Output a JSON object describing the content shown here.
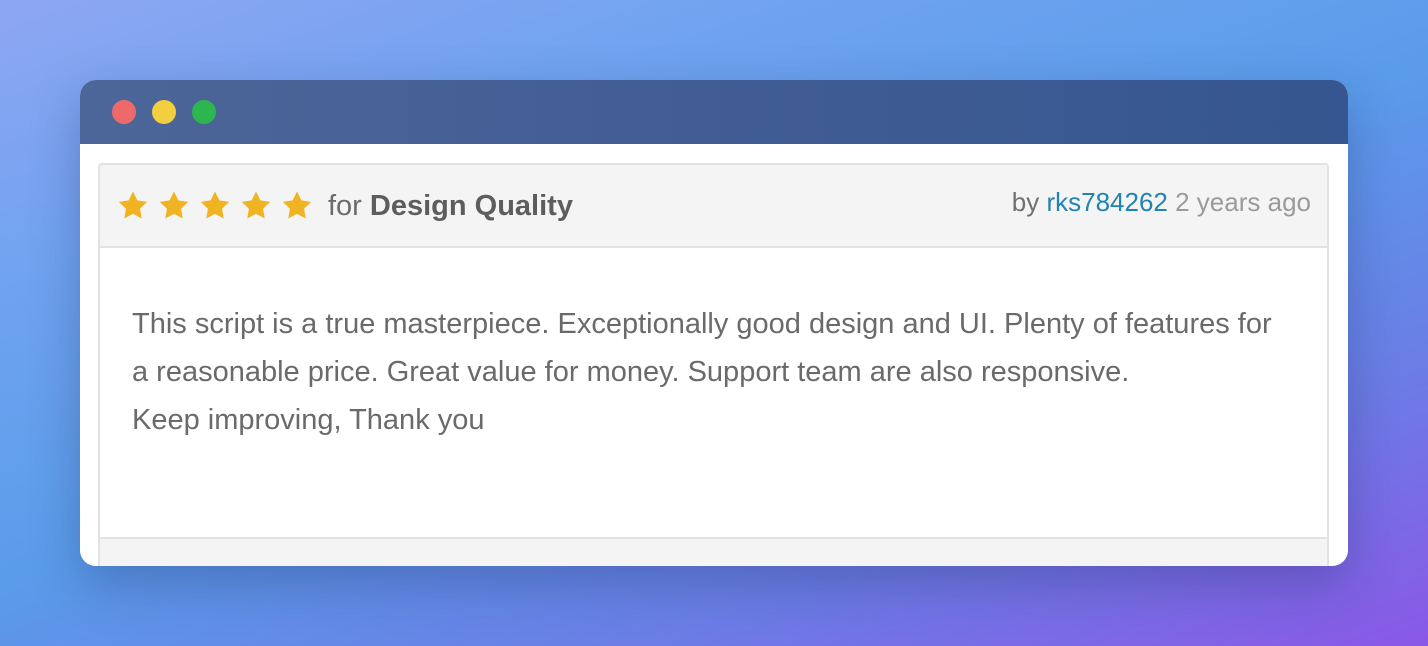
{
  "window": {
    "controls": {
      "close_color": "#ee6a6a",
      "minimize_color": "#f3cf3f",
      "maximize_color": "#2db64f"
    }
  },
  "review": {
    "rating": 5,
    "rating_max": 5,
    "star_color": "#f0b423",
    "for_label": "for",
    "category": "Design Quality",
    "by_label": "by",
    "author": "rks784262",
    "time_ago": "2 years ago",
    "body_lines": [
      "This script is a true masterpiece. Exceptionally good design and UI. Plenty of features for a reasonable price. Great value for money. Support team are also responsive.",
      "Keep improving, Thank you"
    ]
  }
}
